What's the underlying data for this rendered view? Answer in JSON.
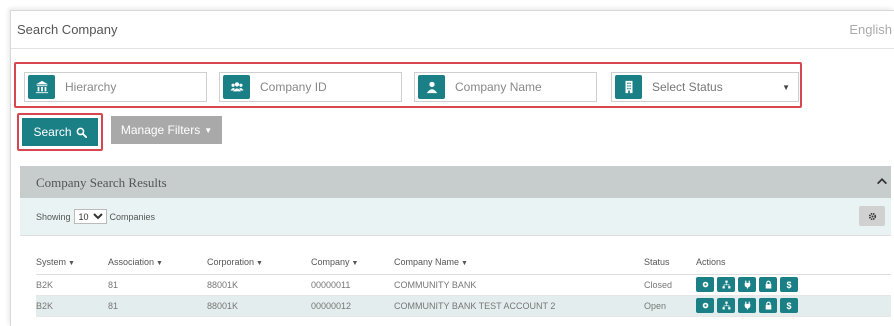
{
  "header": {
    "title": "Search Company",
    "language": "English"
  },
  "filters": {
    "hierarchy": {
      "placeholder": "Hierarchy",
      "icon": "bank-icon"
    },
    "company_id": {
      "placeholder": "Company ID",
      "icon": "users-icon"
    },
    "company_name": {
      "placeholder": "Company Name",
      "icon": "user-icon"
    },
    "status": {
      "selected": "Select Status",
      "icon": "building-icon"
    }
  },
  "buttons": {
    "search_label": "Search",
    "manage_filters_label": "Manage Filters"
  },
  "results": {
    "title": "Company Search Results",
    "showing_prefix": "Showing",
    "page_size": "10",
    "showing_suffix": "Companies",
    "columns": [
      "System",
      "Association",
      "Corporation",
      "Company",
      "Company Name",
      "Status",
      "Actions"
    ],
    "rows": [
      {
        "system": "B2K",
        "association": "81",
        "corporation": "88001K",
        "company": "00000011",
        "company_name": "COMMUNITY BANK",
        "status": "Closed"
      },
      {
        "system": "B2K",
        "association": "81",
        "corporation": "88001K",
        "company": "00000012",
        "company_name": "COMMUNITY BANK TEST ACCOUNT 2",
        "status": "Open"
      }
    ]
  },
  "colors": {
    "accent": "#1b7f86",
    "highlight_border": "#d9464f",
    "panel_header": "#c7cccd",
    "alt_row": "#e4eded"
  }
}
